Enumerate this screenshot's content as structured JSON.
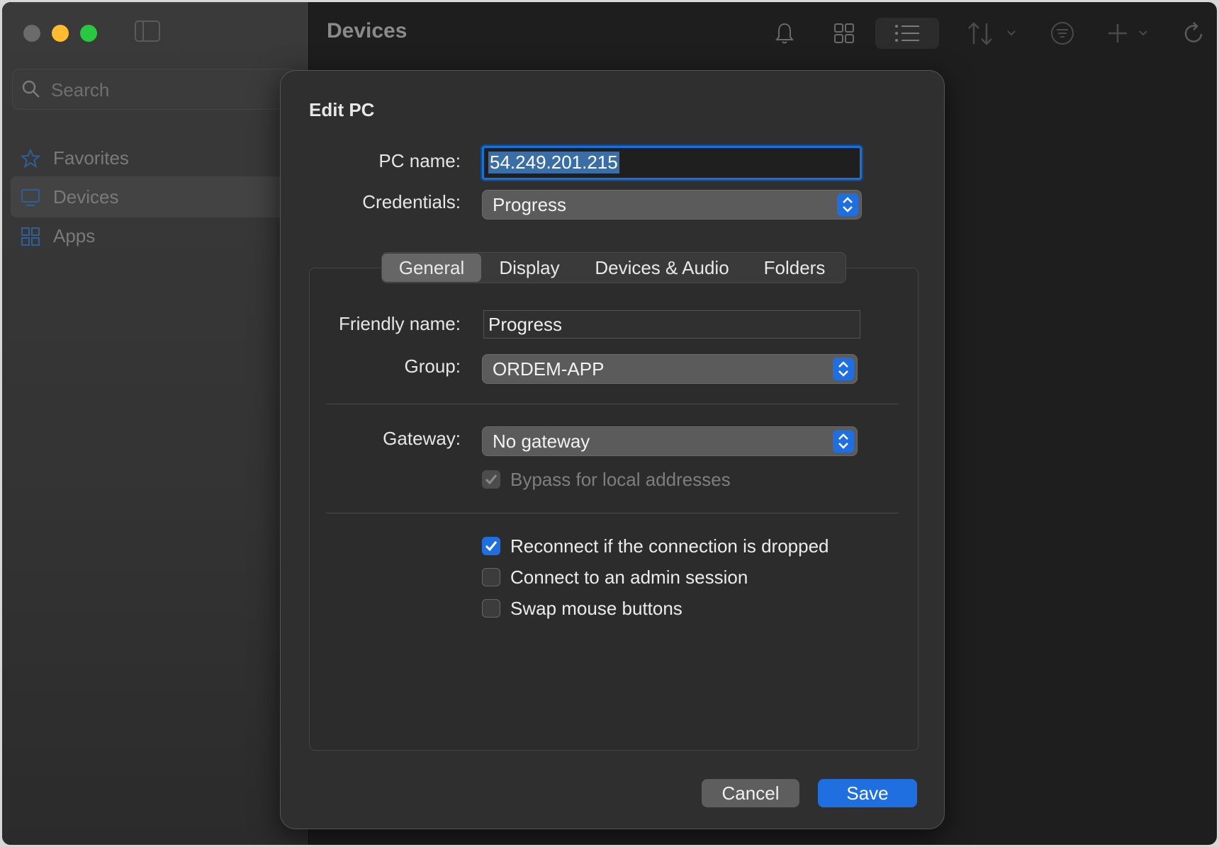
{
  "window": {
    "title": "Devices",
    "search_placeholder": "Search",
    "sidebar": [
      {
        "label": "Favorites",
        "icon": "star-icon"
      },
      {
        "label": "Devices",
        "icon": "monitor-icon"
      },
      {
        "label": "Apps",
        "icon": "apps-icon"
      }
    ],
    "toolbar_icons": [
      "bell-icon",
      "grid-view-icon",
      "list-view-icon",
      "sort-icon",
      "filter-icon",
      "add-icon",
      "refresh-icon"
    ]
  },
  "dialog": {
    "title": "Edit PC",
    "pc_name_label": "PC name:",
    "pc_name_value": "54.249.201.215",
    "credentials_label": "Credentials:",
    "credentials_value": "Progress",
    "tabs": [
      "General",
      "Display",
      "Devices & Audio",
      "Folders"
    ],
    "selected_tab": "General",
    "friendly_name_label": "Friendly name:",
    "friendly_name_value": "Progress",
    "group_label": "Group:",
    "group_value": "ORDEM-APP",
    "gateway_label": "Gateway:",
    "gateway_value": "No gateway",
    "bypass_label": "Bypass for local addresses",
    "reconnect_label": "Reconnect if the connection is dropped",
    "admin_label": "Connect to an admin session",
    "swap_label": "Swap mouse buttons",
    "checkboxes": {
      "bypass": true,
      "reconnect": true,
      "admin": false,
      "swap": false
    },
    "cancel_label": "Cancel",
    "save_label": "Save"
  },
  "colors": {
    "accent": "#1f6fe0",
    "close": "#ff5f57",
    "minimize": "#febc2e",
    "zoom": "#28c840"
  }
}
